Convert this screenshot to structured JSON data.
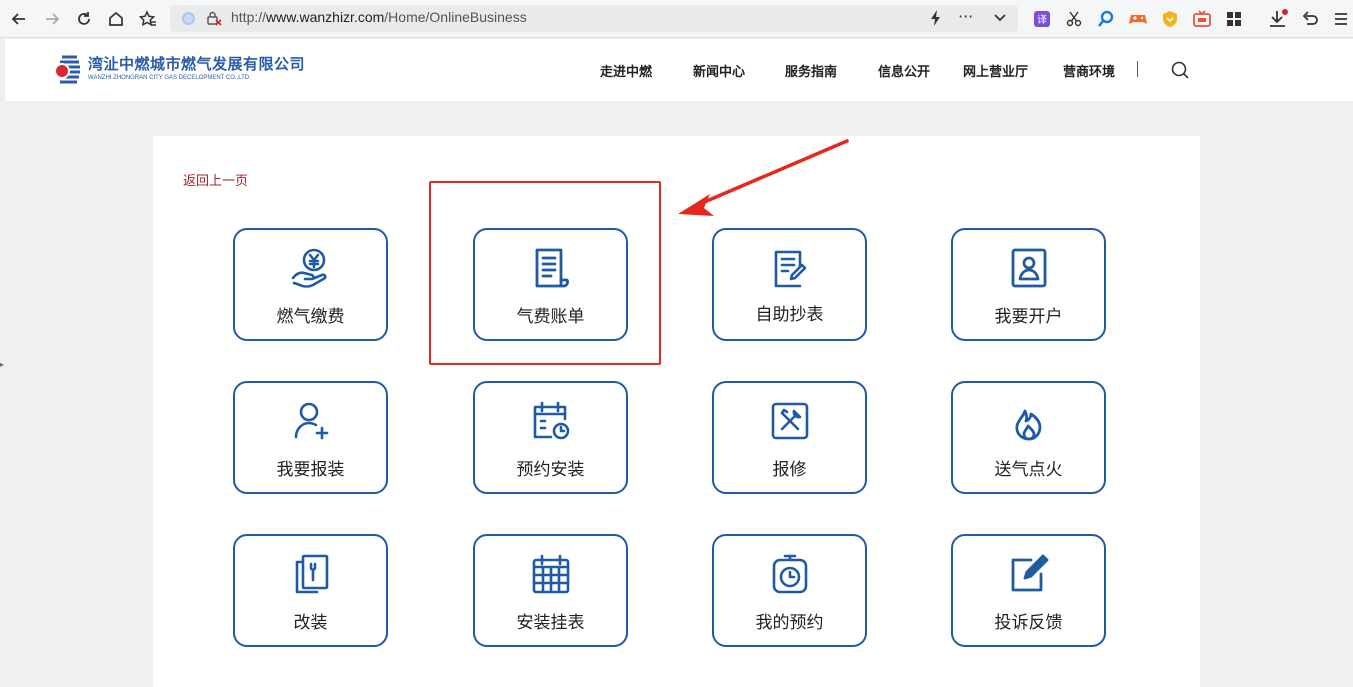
{
  "browser": {
    "url_prefix": "http://",
    "url_domain": "www.wanzhizr.com",
    "url_path": "/Home/OnlineBusiness",
    "translate_badge": "译"
  },
  "header": {
    "logo_cn": "湾沚中燃城市燃气发展有限公司",
    "logo_en": "WANZHI ZHONGRAN CITY GAS DECELOPMENT CO.,LTD.",
    "nav": [
      "走进中燃",
      "新闻中心",
      "服务指南",
      "信息公开",
      "网上营业厅",
      "营商环境"
    ]
  },
  "main": {
    "back_link": "返回上一页",
    "services": [
      {
        "label": "燃气缴费",
        "icon": "hand-yen-icon"
      },
      {
        "label": "气费账单",
        "icon": "bill-icon"
      },
      {
        "label": "自助抄表",
        "icon": "edit-document-icon"
      },
      {
        "label": "我要开户",
        "icon": "contact-card-icon"
      },
      {
        "label": "我要报装",
        "icon": "add-user-icon"
      },
      {
        "label": "预约安装",
        "icon": "calendar-clock-icon"
      },
      {
        "label": "报修",
        "icon": "tools-icon"
      },
      {
        "label": "送气点火",
        "icon": "flame-icon"
      },
      {
        "label": "改装",
        "icon": "wrench-document-icon"
      },
      {
        "label": "安装挂表",
        "icon": "calendar-grid-icon"
      },
      {
        "label": "我的预约",
        "icon": "stopwatch-icon"
      },
      {
        "label": "投诉反馈",
        "icon": "pen-square-icon"
      }
    ]
  },
  "colors": {
    "accent": "#1e5ba4",
    "highlight": "#e5281f",
    "back_link": "#a0262a"
  }
}
